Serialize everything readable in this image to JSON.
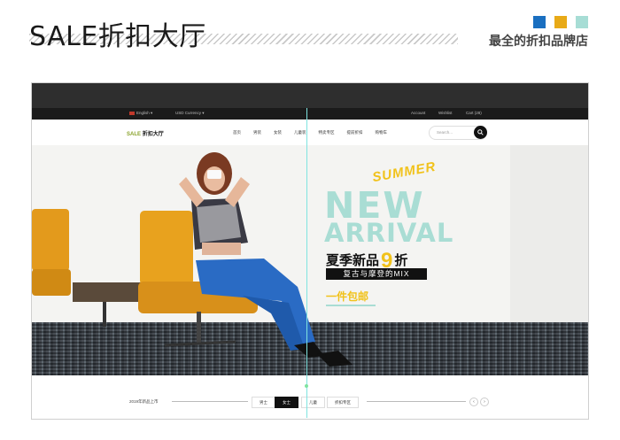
{
  "header": {
    "title": "SALE折扣大厅",
    "tagline": "最全的折扣品牌店",
    "square_colors": [
      "#1a6fc0",
      "#e8aa17",
      "#a7ddd5"
    ]
  },
  "utility": {
    "language": "English",
    "currency": "USD Currency",
    "account": "Account",
    "wishlist": "Wishlist",
    "cart": "Cart (28)"
  },
  "nav": {
    "logo_prefix": "SALE",
    "logo_suffix": "折扣大厅",
    "menu": [
      "首页",
      "男装",
      "女装",
      "儿童装",
      "特卖专区",
      "提前折扣",
      "购物车"
    ],
    "search_placeholder": "Search..."
  },
  "hero": {
    "summer": "SUMMER",
    "new": "NEW",
    "arrival": "ARRIVAL",
    "promo_left": "夏季新品",
    "promo_number": "9",
    "promo_right": "折",
    "mix": "复古与摩登的MIX",
    "shipping": "一件包邮"
  },
  "bottom": {
    "label": "2019年新品上市",
    "tabs": [
      "男士",
      "女士",
      "儿童",
      "折扣专区"
    ],
    "active_tab": "女士"
  }
}
